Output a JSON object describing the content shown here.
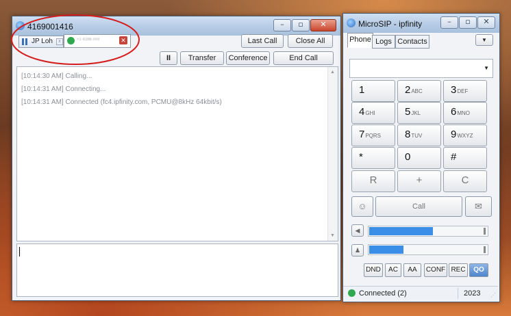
{
  "call_window": {
    "title": "4169001416",
    "session_tabs": [
      {
        "label": "JP Loh"
      },
      {
        "label": "+1 4166 ###"
      }
    ],
    "buttons": {
      "last_call": "Last Call",
      "close_all": "Close All",
      "pause": "II",
      "transfer": "Transfer",
      "conference": "Conference",
      "end_call": "End Call"
    },
    "log": [
      "[10:14:30 AM]  Calling...",
      "[10:14:31 AM]  Connecting...",
      "[10:14:31 AM]  Connected (fc4.ipfinity.com, PCMU@8kHz 64kbit/s)"
    ],
    "message_input": ""
  },
  "phone_window": {
    "title": "MicroSIP - ipfinity",
    "tabs": [
      "Phone",
      "Logs",
      "Contacts"
    ],
    "number_input": "",
    "keypad": [
      {
        "digit": "1",
        "letters": ""
      },
      {
        "digit": "2",
        "letters": "ABC"
      },
      {
        "digit": "3",
        "letters": "DEF"
      },
      {
        "digit": "4",
        "letters": "GHI"
      },
      {
        "digit": "5",
        "letters": "JKL"
      },
      {
        "digit": "6",
        "letters": "MNO"
      },
      {
        "digit": "7",
        "letters": "PQRS"
      },
      {
        "digit": "8",
        "letters": "TUV"
      },
      {
        "digit": "9",
        "letters": "WXYZ"
      },
      {
        "digit": "*",
        "letters": ""
      },
      {
        "digit": "0",
        "letters": ""
      },
      {
        "digit": "#",
        "letters": ""
      }
    ],
    "function_keys": [
      "R",
      "+",
      "C"
    ],
    "call_label": "Call",
    "speaker_level": 0.6,
    "mic_level": 0.3,
    "feature_buttons": [
      "DND",
      "AC",
      "AA",
      "CONF",
      "REC"
    ],
    "voicemail_glyph": "QO",
    "status": "Connected (2)",
    "status_number": "2023",
    "accent": "#3b8ee8"
  }
}
